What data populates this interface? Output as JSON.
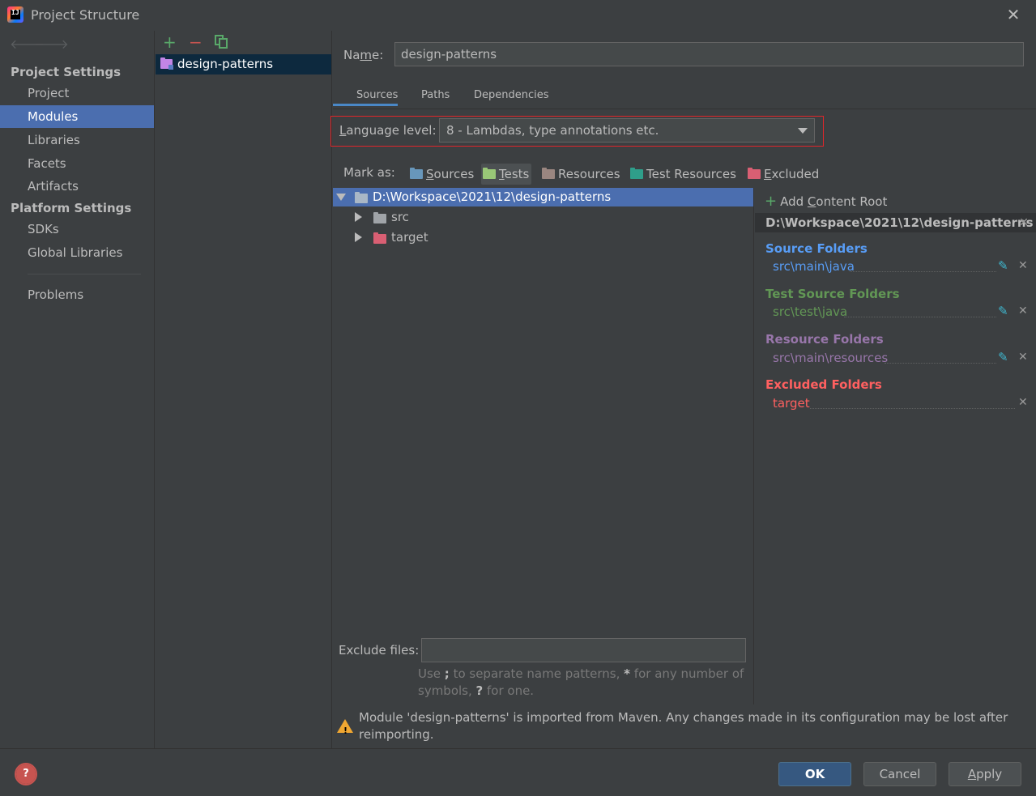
{
  "window": {
    "title": "Project Structure"
  },
  "sidebar": {
    "project_settings_heading": "Project Settings",
    "project_items": [
      "Project",
      "Modules",
      "Libraries",
      "Facets",
      "Artifacts"
    ],
    "platform_settings_heading": "Platform Settings",
    "platform_items": [
      "SDKs",
      "Global Libraries"
    ],
    "problems": "Problems",
    "selected": "Modules"
  },
  "modules_panel": {
    "add_icon": "+",
    "remove_icon": "−",
    "copy_icon": "copy-icon",
    "module_name": "design-patterns"
  },
  "module": {
    "name_label": "Name:",
    "name_value": "design-patterns",
    "tabs": [
      "Sources",
      "Paths",
      "Dependencies"
    ],
    "active_tab": "Sources",
    "language_level_label": "Language level:",
    "language_level_value": "8 - Lambdas, type annotations etc.",
    "mark_as_label": "Mark as:",
    "mark_as": [
      {
        "label": "Sources",
        "color": "#6897bb"
      },
      {
        "label": "Tests",
        "color": "#99c777"
      },
      {
        "label": "Resources",
        "color": "#9a8680"
      },
      {
        "label": "Test Resources",
        "color": "#2f9e8a"
      },
      {
        "label": "Excluded",
        "color": "#d95f73"
      }
    ],
    "tree": {
      "root": "D:\\Workspace\\2021\\12\\design-patterns",
      "children": [
        {
          "name": "src",
          "color": "#a0a4a8"
        },
        {
          "name": "target",
          "color": "#d95f73"
        }
      ]
    },
    "exclude_files_label": "Exclude files:",
    "exclude_files_value": "",
    "hint_prefix": "Use ",
    "hint_sep": ";",
    "hint_mid": " to separate name patterns, ",
    "hint_star": "*",
    "hint_mid2": " for any number of symbols, ",
    "hint_q": "?",
    "hint_end": " for one.",
    "warning": "Module 'design-patterns' is imported from Maven. Any changes made in its configuration may be lost after reimporting."
  },
  "content_root": {
    "add_label": "Add Content Root",
    "root_path": "D:\\Workspace\\2021\\12\\design-patterns",
    "sections": [
      {
        "heading": "Source Folders",
        "path": "src\\main\\java",
        "color": "#589df6",
        "editable": true
      },
      {
        "heading": "Test Source Folders",
        "path": "src\\test\\java",
        "color": "#629755",
        "editable": true
      },
      {
        "heading": "Resource Folders",
        "path": "src\\main\\resources",
        "color": "#9876aa",
        "editable": true
      },
      {
        "heading": "Excluded Folders",
        "path": "target",
        "color": "#ff6060",
        "editable": false
      }
    ]
  },
  "buttons": {
    "ok": "OK",
    "cancel": "Cancel",
    "apply": "Apply"
  }
}
